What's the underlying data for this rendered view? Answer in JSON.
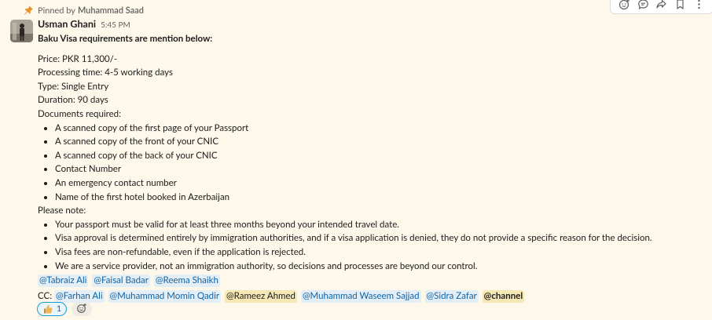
{
  "pinned": {
    "prefix": "Pinned by",
    "by": "Muhammad Saad"
  },
  "message": {
    "author": "Usman Ghani",
    "time": "5:45 PM",
    "heading": "Baku Visa requirements are mention below:",
    "details": [
      "Price: PKR 11,300/-",
      "Processing time: 4-5 working days",
      "Type: Single Entry",
      "Duration: 90 days",
      "Documents required:"
    ],
    "documents": [
      "A scanned copy of the first page of your Passport",
      "A scanned copy of the front of your CNIC",
      "A scanned copy of the back of your CNIC",
      "Contact Number",
      "An emergency contact number",
      "Name of the first hotel booked in Azerbaijan"
    ],
    "note_label": "Please note:",
    "notes": [
      "Your passport must be valid for at least three months beyond your intended travel date.",
      "Visa approval is determined entirely by immigration authorities, and if a visa application is denied, they do not provide a specific reason for the decision.",
      "Visa fees are non-refundable, even if the application is rejected.",
      "We are a service provider, not an immigration authority, so decisions and processes are beyond our control."
    ],
    "mentions": [
      "@Tabraiz Ali",
      "@Faisal Badar",
      "@Reema Shaikh"
    ],
    "cc_label": "CC:",
    "cc_mentions": [
      "@Farhan Ali",
      "@Muhammad Momin Qadir",
      "@Rameez Ahmed",
      "@Muhammad Waseem Sajjad",
      "@Sidra Zafar"
    ],
    "channel_mention": "@channel"
  },
  "reactions": [
    {
      "emoji": "thumbs-up",
      "count": "1"
    }
  ],
  "toolbar": [
    "add-reaction-icon",
    "reply-in-thread-icon",
    "forward-icon",
    "save-for-later-icon",
    "more-actions-icon"
  ],
  "colors": {
    "background": "#fdf8ea",
    "mention_bg": "#e3eef6",
    "mention_text": "#1264a3",
    "self_mention_bg": "#f6e8b5",
    "pin_orange": "#e8912d"
  }
}
